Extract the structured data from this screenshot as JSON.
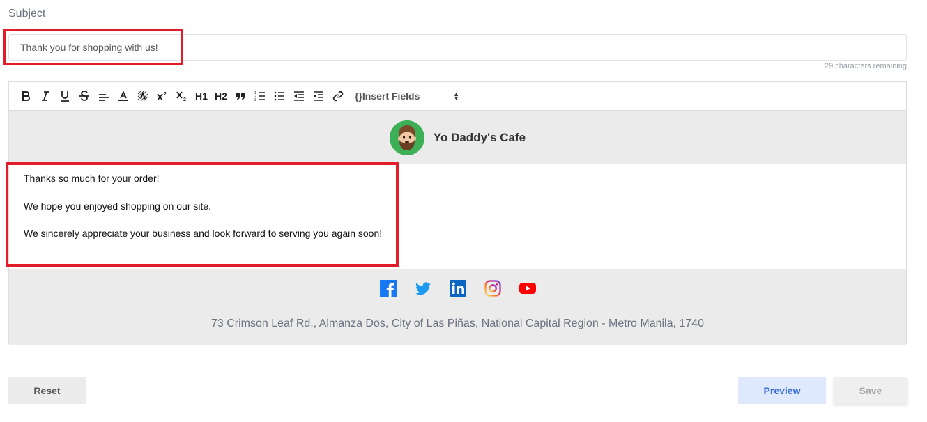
{
  "subject": {
    "label": "Subject",
    "value": "Thank you for shopping with us!",
    "chars_remaining": "29 characters remaining"
  },
  "toolbar": {
    "buttons": [
      "bold",
      "italic",
      "underline",
      "strikethrough",
      "align",
      "text-color",
      "background-color",
      "superscript",
      "subscript",
      "heading-1",
      "heading-2",
      "blockquote",
      "ordered-list",
      "bullet-list",
      "outdent",
      "indent",
      "link"
    ],
    "h1_label": "H1",
    "h2_label": "H2",
    "insert_fields": "{}Insert Fields"
  },
  "email": {
    "shop_name": "Yo Daddy's Cafe",
    "body": {
      "line1": "Thanks so much for your order!",
      "line2": "We hope you enjoyed shopping on our site.",
      "line3": "We sincerely appreciate your business and look forward to serving you again soon!"
    },
    "socials": [
      "facebook",
      "twitter",
      "linkedin",
      "instagram",
      "youtube"
    ],
    "address": "73 Crimson Leaf Rd., Almanza Dos, City of Las Piñas, National Capital Region - Metro Manila, 1740"
  },
  "actions": {
    "reset": "Reset",
    "preview": "Preview",
    "save": "Save"
  },
  "colors": {
    "highlight": "#e11d2a",
    "preview_text": "#3a6fd8",
    "preview_bg": "#dfe9fd",
    "logo_bg": "#3daf57"
  }
}
